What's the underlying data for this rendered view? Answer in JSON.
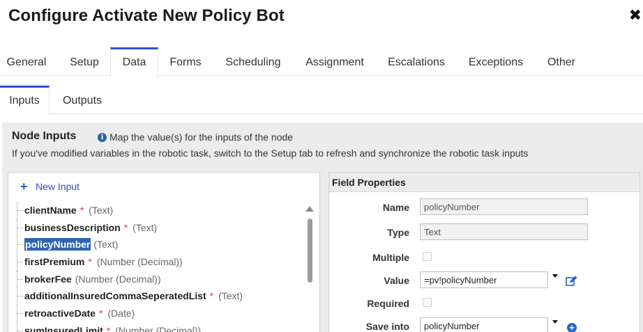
{
  "dialog": {
    "title": "Configure Activate New Policy Bot",
    "close_label": "✖"
  },
  "tabs": [
    {
      "label": "General"
    },
    {
      "label": "Setup"
    },
    {
      "label": "Data"
    },
    {
      "label": "Forms"
    },
    {
      "label": "Scheduling"
    },
    {
      "label": "Assignment"
    },
    {
      "label": "Escalations"
    },
    {
      "label": "Exceptions"
    },
    {
      "label": "Other"
    }
  ],
  "active_tab": "Data",
  "subtabs": [
    {
      "label": "Inputs"
    },
    {
      "label": "Outputs"
    }
  ],
  "active_subtab": "Inputs",
  "node_inputs": {
    "title": "Node Inputs",
    "info_icon": "i",
    "info_text": "Map the value(s) for the inputs of the node",
    "hint": "If you've modified variables in the robotic task, switch to the Setup tab to refresh and synchronize the robotic task inputs"
  },
  "new_input_label": "New Input",
  "inputs": [
    {
      "name": "clientName",
      "required": "*",
      "type": "(Text)"
    },
    {
      "name": "businessDescription",
      "required": "*",
      "type": "(Text)"
    },
    {
      "name": "policyNumber",
      "required": "",
      "type": "(Text)",
      "selected": true
    },
    {
      "name": "firstPremium",
      "required": "*",
      "type": "(Number (Decimal))"
    },
    {
      "name": "brokerFee",
      "required": "",
      "type": "(Number (Decimal))"
    },
    {
      "name": "additionalInsuredCommaSeperatedList",
      "required": "*",
      "type": "(Text)"
    },
    {
      "name": "retroactiveDate",
      "required": "*",
      "type": "(Date)"
    },
    {
      "name": "sumInsuredLimit",
      "required": "*",
      "type": "(Number (Decimal))"
    }
  ],
  "field_properties": {
    "header": "Field Properties",
    "name_label": "Name",
    "name_value": "policyNumber",
    "type_label": "Type",
    "type_value": "Text",
    "multiple_label": "Multiple",
    "multiple_checked": false,
    "value_label": "Value",
    "value_value": "=pv!policyNumber",
    "required_label": "Required",
    "required_checked": false,
    "save_into_label": "Save into",
    "save_into_value": "policyNumber"
  },
  "colors": {
    "accent": "#2f4fd0",
    "selection": "#2f64b3",
    "required": "#d63b3b",
    "link": "#2a4fb0"
  }
}
